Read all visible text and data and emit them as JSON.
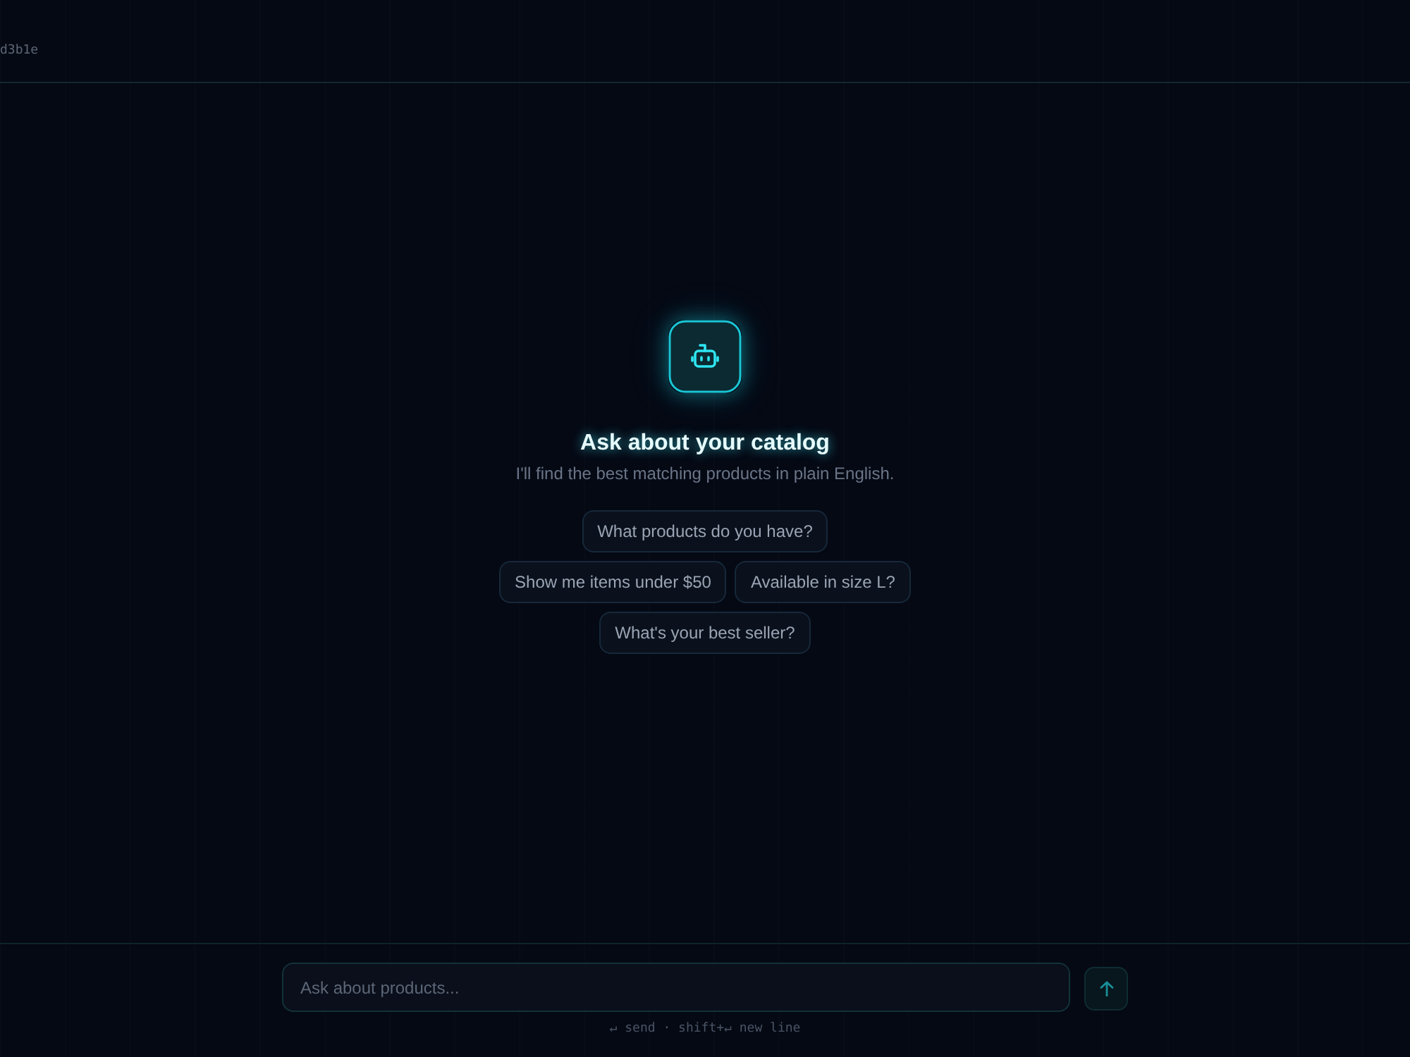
{
  "header": {
    "session_id": "d3b1e"
  },
  "empty_state": {
    "title": "Ask about your catalog",
    "subtitle": "I'll find the best matching products in plain English.",
    "suggestion_rows": [
      [
        "What products do you have?"
      ],
      [
        "Show me items under $50",
        "Available in size L?"
      ],
      [
        "What's your best seller?"
      ]
    ]
  },
  "composer": {
    "placeholder": "Ask about products...",
    "hint": "↵ send · shift+↵ new line"
  }
}
